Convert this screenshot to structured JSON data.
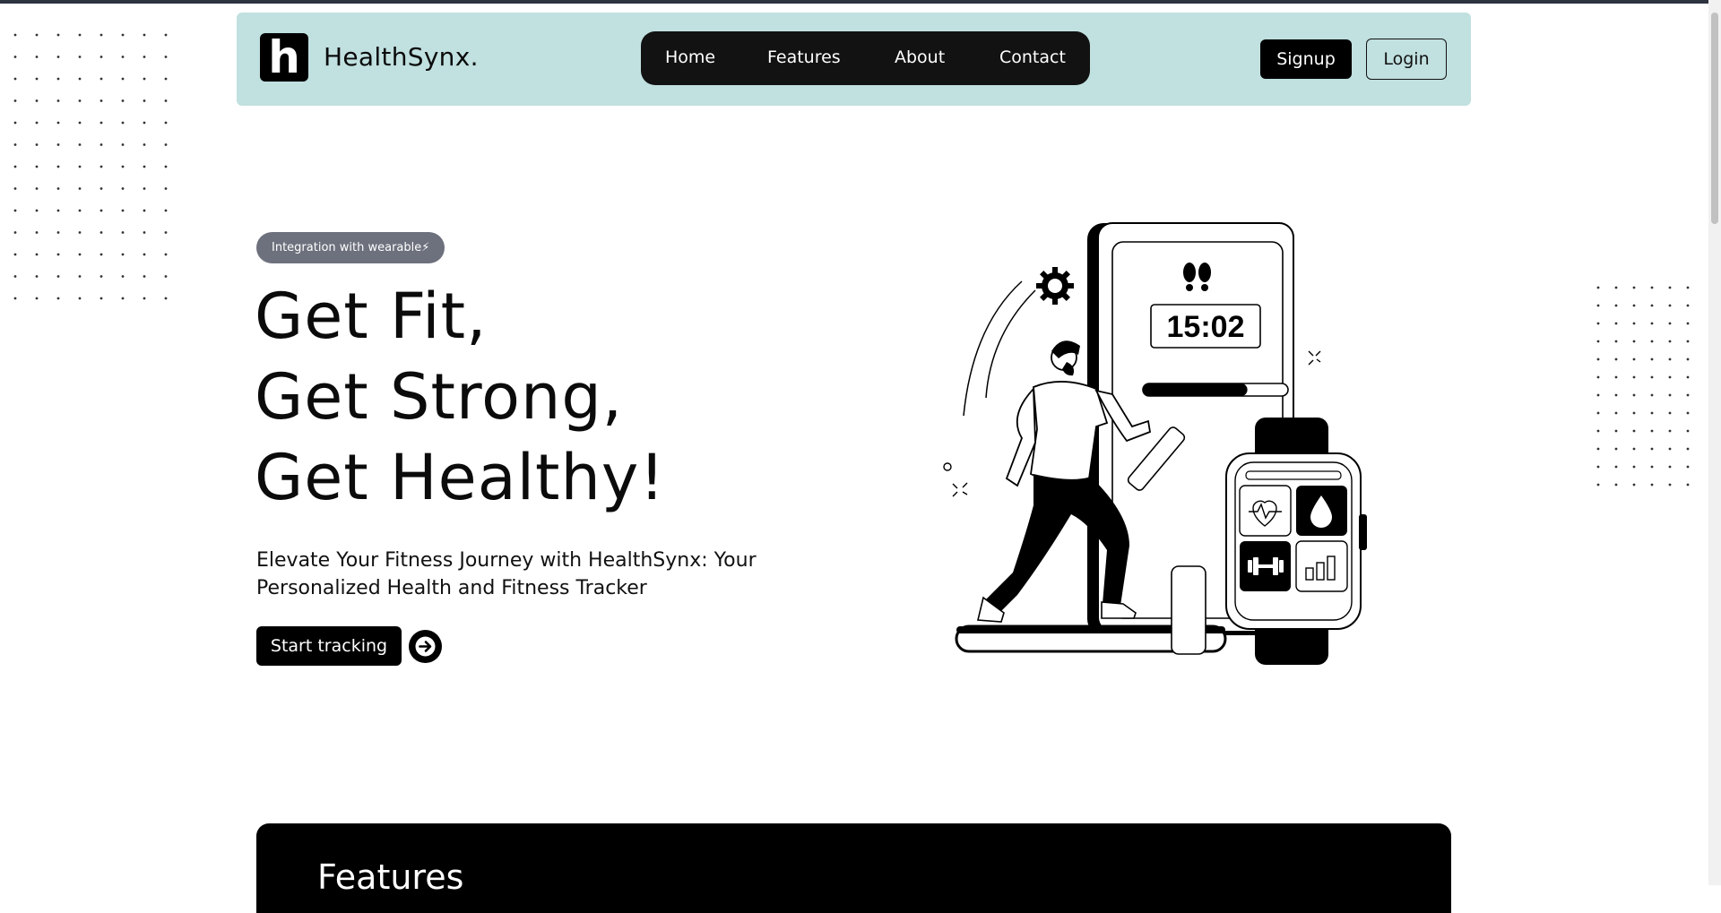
{
  "brand": {
    "logo_letter": "h",
    "name": "HealthSynx."
  },
  "nav": {
    "links": [
      {
        "label": "Home"
      },
      {
        "label": "Features"
      },
      {
        "label": "About"
      },
      {
        "label": "Contact"
      }
    ],
    "signup_label": "Signup",
    "login_label": "Login"
  },
  "hero": {
    "badge": "Integration with wearable⚡",
    "headline": [
      "Get Fit,",
      "Get Strong,",
      "Get Healthy!"
    ],
    "subtitle": "Elevate Your Fitness Journey with HealthSynx: Your Personalized Health and Fitness Tracker",
    "cta_label": "Start tracking",
    "cta_icon": "arrow-right-icon"
  },
  "illustration": {
    "timer": "15:02",
    "progress_fraction": 0.72,
    "watch_icons": [
      "heart-rate-icon",
      "water-drop-icon",
      "dumbbell-icon",
      "bar-chart-icon"
    ]
  },
  "features_section": {
    "title": "Features"
  },
  "colors": {
    "navbar_bg": "#c1e0e0",
    "nav_pill_bg": "#121212",
    "badge_bg": "#6d717d",
    "primary": "#000000"
  }
}
